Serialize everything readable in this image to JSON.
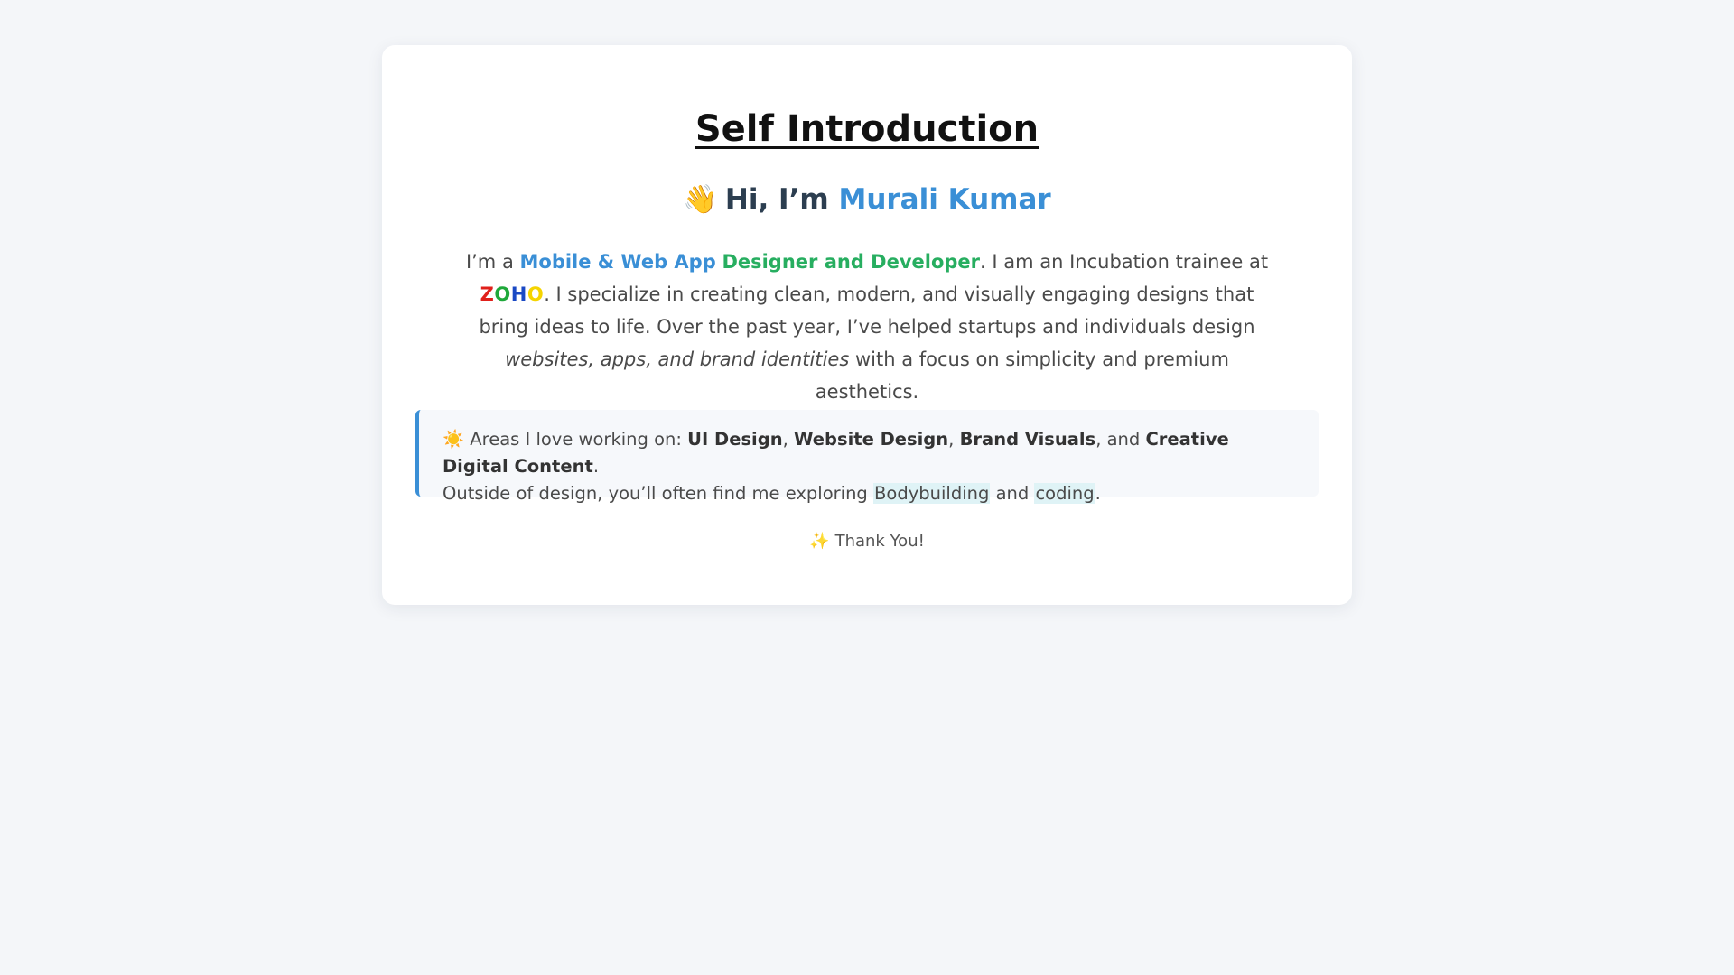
{
  "title": "Self Introduction",
  "greeting": {
    "icon": "waving-hand-icon",
    "prefix": "Hi, I’m",
    "name": "Murali Kumar"
  },
  "intro": {
    "part1": "I’m a",
    "role_blue": "Mobile & Web App",
    "role_green": "Designer and Developer",
    "part2": ". I am an Incubation trainee at",
    "company_letters": [
      "Z",
      "O",
      "H",
      "O"
    ],
    "company_colors": [
      "#e0201b",
      "#1fa83a",
      "#1a49c4",
      "#f5d400"
    ],
    "part3": ".  I specialize in creating clean, modern, and visually engaging designs that bring ideas to life. Over the past year, I’ve helped startups and individuals design",
    "emphasis": "websites, apps, and brand identities",
    "part4": "with a focus on simplicity and premium aesthetics."
  },
  "areas": {
    "icon": "sun-icon",
    "lead": "Areas I love working on:",
    "items": [
      "UI Design",
      "Website Design",
      "Brand Visuals",
      "Creative Digital Content"
    ],
    "and_word": "and",
    "outside_text": "Outside of design, you’ll often find me exploring",
    "hobbies": [
      "Bodybuilding",
      "coding"
    ]
  },
  "thanks": {
    "icon": "sparkles-icon",
    "text": "Thank You!"
  },
  "colors": {
    "accent_blue": "#3a8fd6",
    "accent_green": "#27ae60",
    "page_background": "#f4f6f9",
    "card_background": "#ffffff",
    "hobby_highlight": "#dff3f6"
  }
}
